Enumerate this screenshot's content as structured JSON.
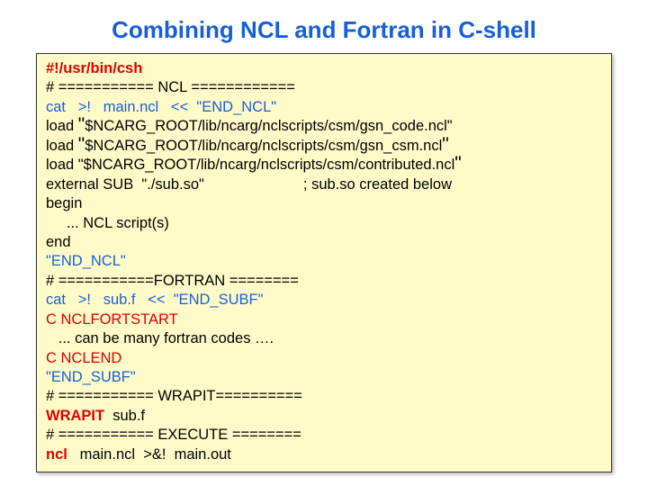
{
  "title": "Combining NCL and Fortran in C-shell",
  "lines": {
    "l01": "#!/usr/bin/csh",
    "l02": "# =========== NCL ============",
    "l03": "cat   >!   main.ncl   <<  \"END_NCL\"",
    "l04a": "load ",
    "l04b": "\"",
    "l04c": "$NCARG_ROOT/lib/ncarg/nclscripts/csm/gsn_code.ncl\"",
    "l05a": "load ",
    "l05b": "\"",
    "l05c": "$NCARG_ROOT/lib/ncarg/nclscripts/csm/gsn_csm.ncl",
    "l05d": "\"",
    "l06a": "load \"$NCARG_ROOT/lib/ncarg/nclscripts/csm/contributed.ncl",
    "l06b": "\"",
    "l07": "external SUB  \"./sub.so\"                        ; sub.so created below",
    "l08": "begin",
    "l09": "     ... NCL script(s)",
    "l10": "end",
    "l11": "\"END_NCL\"",
    "l12": "# ===========FORTRAN ========",
    "l13": "cat   >!   sub.f   <<  \"END_SUBF\"",
    "l14": "C NCLFORTSTART",
    "l15": "   ... can be many fortran codes ….",
    "l16": "C NCLEND",
    "l17": "\"END_SUBF\"",
    "l18": "# =========== WRAPIT==========",
    "l19a": "WRAPIT",
    "l19b": "  sub.f",
    "l20": "# =========== EXECUTE ========",
    "l21a": "ncl",
    "l21b": "   main.ncl  >&!  main.out"
  }
}
